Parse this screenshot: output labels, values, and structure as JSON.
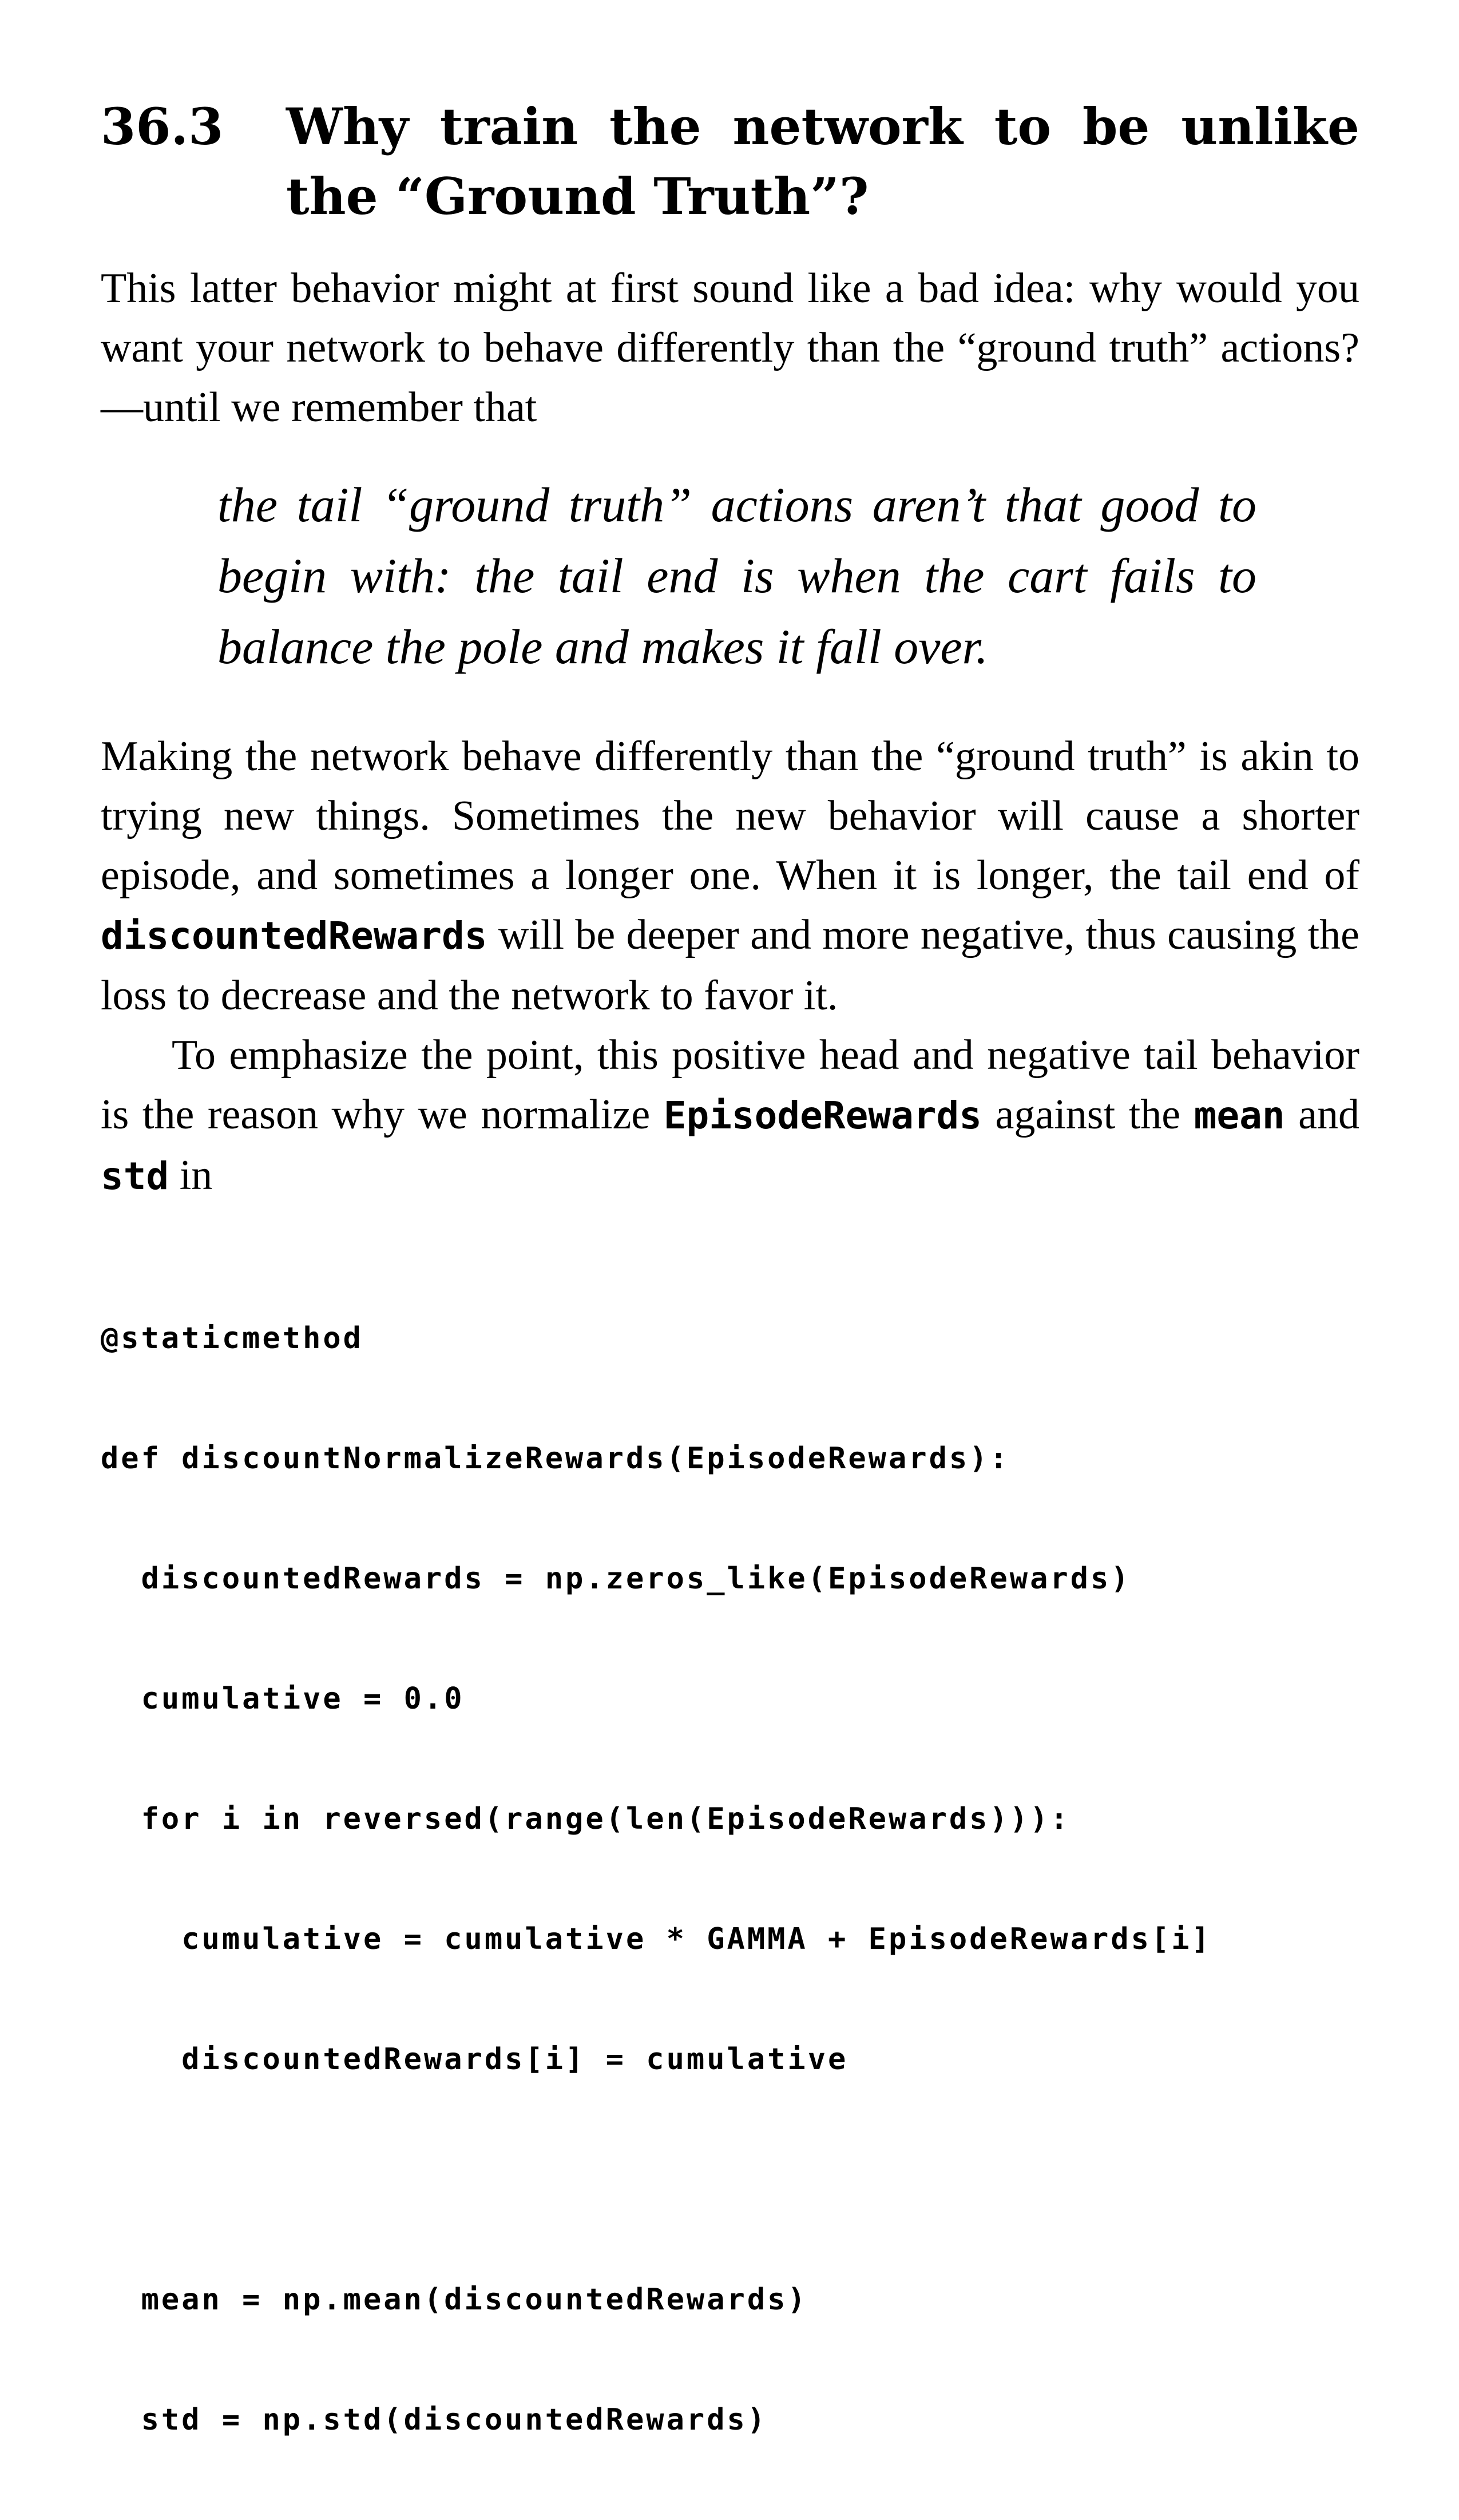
{
  "section": {
    "number": "36.3",
    "title": "Why train the network to be unlike the “Ground Truth”?"
  },
  "paragraph1": {
    "text": "This latter behavior might at first sound like a bad idea: why would you want your network to behave differently than the “ground truth” actions?—until we remember that"
  },
  "quote": {
    "text": "the tail “ground truth” actions aren’t that good to begin with: the tail end is when the cart fails to balance the pole and makes it fall over."
  },
  "paragraph2": {
    "part1": "Making the network behave differently than the “ground truth” is akin to trying new things. Sometimes the new behavior will cause a shorter episode, and sometimes a longer one. When it is longer, the tail end of ",
    "code1": "discountedRewards",
    "part2": " will be deeper and more negative, thus causing the loss to decrease and the network to favor it."
  },
  "paragraph3": {
    "part1": "To emphasize the point, this positive head and negative tail behavior is the reason why we normalize ",
    "code1": "EpisodeRewards",
    "part2": " against the ",
    "code2": "mean",
    "part3": " and ",
    "code3": "std",
    "part4": " in"
  },
  "code_block": {
    "lines": [
      "@staticmethod",
      "def discountNormalizeRewards(EpisodeRewards):",
      "  discountedRewards = np.zeros_like(EpisodeRewards)",
      "  cumulative = 0.0",
      "  for i in reversed(range(len(EpisodeRewards))):",
      "    cumulative = cumulative * GAMMA + EpisodeRewards[i]",
      "    discountedRewards[i] = cumulative",
      "",
      "  mean = np.mean(discountedRewards)",
      "  std = np.std(discountedRewards)"
    ]
  }
}
